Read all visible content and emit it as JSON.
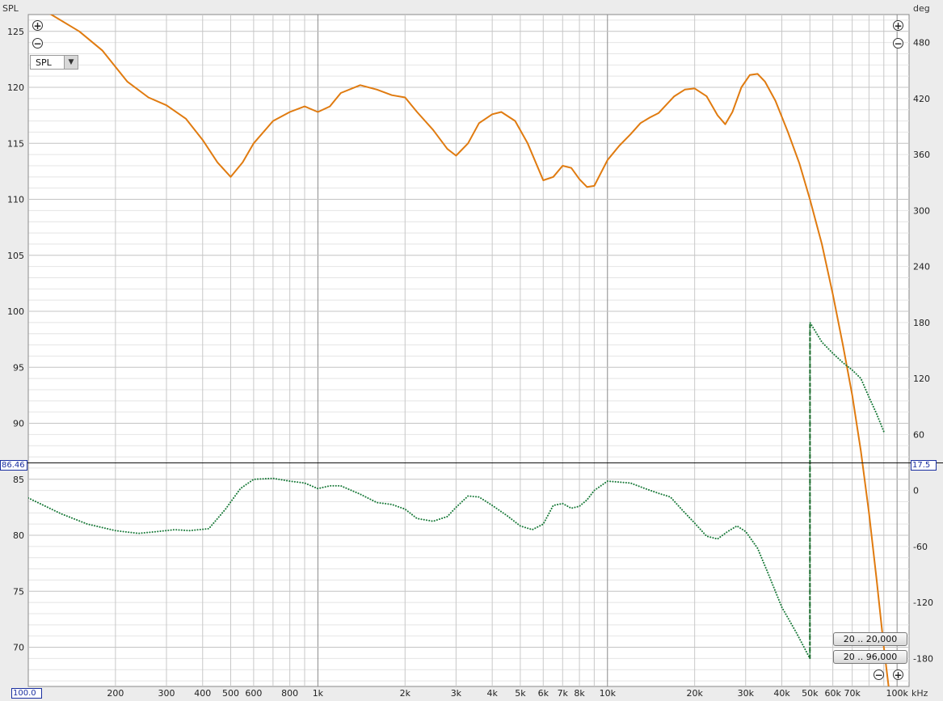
{
  "chart_data": {
    "type": "line",
    "left_axis": {
      "label": "SPL",
      "ticks": [
        70,
        75,
        80,
        85,
        90,
        95,
        100,
        105,
        110,
        115,
        120,
        125
      ],
      "range": [
        66.5,
        126.5
      ]
    },
    "right_axis": {
      "label": "deg",
      "ticks": [
        -180,
        -120,
        -60,
        0,
        60,
        120,
        180,
        240,
        300,
        360,
        420,
        480
      ],
      "range": [
        -210,
        510
      ]
    },
    "x_axis": {
      "unit": "kHz",
      "scale": "log",
      "range": [
        100,
        110000
      ],
      "tick_values": [
        200,
        300,
        400,
        500,
        600,
        800,
        1000,
        2000,
        3000,
        4000,
        5000,
        6000,
        7000,
        8000,
        10000,
        20000,
        30000,
        40000,
        50000,
        60000,
        70000,
        100000
      ],
      "tick_labels": [
        "200",
        "300",
        "400",
        "500",
        "600",
        "800",
        "1k",
        "2k",
        "3k",
        "4k",
        "5k",
        "6k",
        "7k",
        "8k",
        "10k",
        "20k",
        "30k",
        "40k",
        "50k",
        "60k",
        "70k",
        "100k"
      ]
    },
    "series": [
      {
        "axis": "left",
        "color": "#e07b10",
        "style": "solid",
        "points": [
          [
            100,
            127.5
          ],
          [
            120,
            126.5
          ],
          [
            150,
            125
          ],
          [
            180,
            123.3
          ],
          [
            220,
            120.5
          ],
          [
            260,
            119.1
          ],
          [
            300,
            118.4
          ],
          [
            350,
            117.2
          ],
          [
            400,
            115.3
          ],
          [
            450,
            113.3
          ],
          [
            500,
            112
          ],
          [
            550,
            113.3
          ],
          [
            600,
            115
          ],
          [
            700,
            117
          ],
          [
            800,
            117.8
          ],
          [
            900,
            118.3
          ],
          [
            1000,
            117.8
          ],
          [
            1100,
            118.3
          ],
          [
            1200,
            119.5
          ],
          [
            1400,
            120.2
          ],
          [
            1600,
            119.8
          ],
          [
            1800,
            119.3
          ],
          [
            2000,
            119.1
          ],
          [
            2200,
            117.8
          ],
          [
            2500,
            116.2
          ],
          [
            2800,
            114.5
          ],
          [
            3000,
            113.9
          ],
          [
            3300,
            115
          ],
          [
            3600,
            116.8
          ],
          [
            4000,
            117.6
          ],
          [
            4300,
            117.8
          ],
          [
            4800,
            117
          ],
          [
            5300,
            115
          ],
          [
            6000,
            111.7
          ],
          [
            6500,
            112
          ],
          [
            7000,
            113
          ],
          [
            7500,
            112.8
          ],
          [
            8000,
            111.8
          ],
          [
            8500,
            111.1
          ],
          [
            9000,
            111.2
          ],
          [
            10000,
            113.5
          ],
          [
            11000,
            114.8
          ],
          [
            12000,
            115.8
          ],
          [
            13000,
            116.8
          ],
          [
            14000,
            117.3
          ],
          [
            15000,
            117.7
          ],
          [
            17000,
            119.2
          ],
          [
            18500,
            119.8
          ],
          [
            20000,
            119.9
          ],
          [
            22000,
            119.2
          ],
          [
            24000,
            117.5
          ],
          [
            25500,
            116.7
          ],
          [
            27000,
            117.8
          ],
          [
            29000,
            120
          ],
          [
            31000,
            121.1
          ],
          [
            33000,
            121.2
          ],
          [
            35000,
            120.5
          ],
          [
            38000,
            118.8
          ],
          [
            42000,
            116
          ],
          [
            46000,
            113.2
          ],
          [
            50000,
            110
          ],
          [
            55000,
            106
          ],
          [
            60000,
            101.5
          ],
          [
            65000,
            97
          ],
          [
            70000,
            92.5
          ],
          [
            75000,
            87.5
          ],
          [
            80000,
            82
          ],
          [
            85000,
            76
          ],
          [
            90000,
            70
          ],
          [
            95000,
            65
          ]
        ]
      },
      {
        "axis": "right",
        "color": "#1a7a3a",
        "style": "dotted",
        "points": [
          [
            100,
            -8
          ],
          [
            130,
            -25
          ],
          [
            160,
            -36
          ],
          [
            200,
            -43
          ],
          [
            240,
            -46
          ],
          [
            280,
            -44
          ],
          [
            320,
            -42
          ],
          [
            360,
            -43
          ],
          [
            420,
            -41
          ],
          [
            480,
            -20
          ],
          [
            540,
            2
          ],
          [
            600,
            12
          ],
          [
            700,
            13
          ],
          [
            800,
            10
          ],
          [
            900,
            8
          ],
          [
            1000,
            2
          ],
          [
            1100,
            5
          ],
          [
            1200,
            5
          ],
          [
            1400,
            -4
          ],
          [
            1600,
            -13
          ],
          [
            1800,
            -15
          ],
          [
            2000,
            -20
          ],
          [
            2200,
            -30
          ],
          [
            2500,
            -33
          ],
          [
            2800,
            -28
          ],
          [
            3000,
            -18
          ],
          [
            3300,
            -6
          ],
          [
            3600,
            -7
          ],
          [
            4000,
            -16
          ],
          [
            4500,
            -27
          ],
          [
            5000,
            -38
          ],
          [
            5500,
            -42
          ],
          [
            6000,
            -36
          ],
          [
            6500,
            -16
          ],
          [
            7000,
            -14
          ],
          [
            7500,
            -19
          ],
          [
            8000,
            -17
          ],
          [
            8500,
            -10
          ],
          [
            9000,
            0
          ],
          [
            10000,
            10
          ],
          [
            12000,
            8
          ],
          [
            13500,
            2
          ],
          [
            15000,
            -3
          ],
          [
            16500,
            -7
          ],
          [
            18000,
            -20
          ],
          [
            20000,
            -35
          ],
          [
            22000,
            -49
          ],
          [
            24000,
            -52
          ],
          [
            26000,
            -44
          ],
          [
            28000,
            -38
          ],
          [
            30000,
            -44
          ],
          [
            33000,
            -62
          ],
          [
            36000,
            -90
          ],
          [
            40000,
            -125
          ],
          [
            45000,
            -153
          ],
          [
            50000,
            -180
          ],
          [
            50050,
            180
          ],
          [
            55000,
            159
          ],
          [
            60000,
            147
          ],
          [
            65000,
            137
          ],
          [
            70000,
            129
          ],
          [
            75000,
            120
          ],
          [
            80000,
            100
          ],
          [
            85000,
            82
          ],
          [
            90000,
            63
          ]
        ]
      }
    ],
    "cursor": {
      "left_value": "86.46",
      "right_value": "17.5",
      "x_value": "100.0"
    }
  },
  "ui": {
    "zoom_in_glyph": "+",
    "zoom_out_glyph": "−",
    "dropdown_value": "SPL",
    "dropdown_arrow": "▼",
    "range_buttons": [
      "20 .. 20,000",
      "20 .. 96,000"
    ]
  }
}
